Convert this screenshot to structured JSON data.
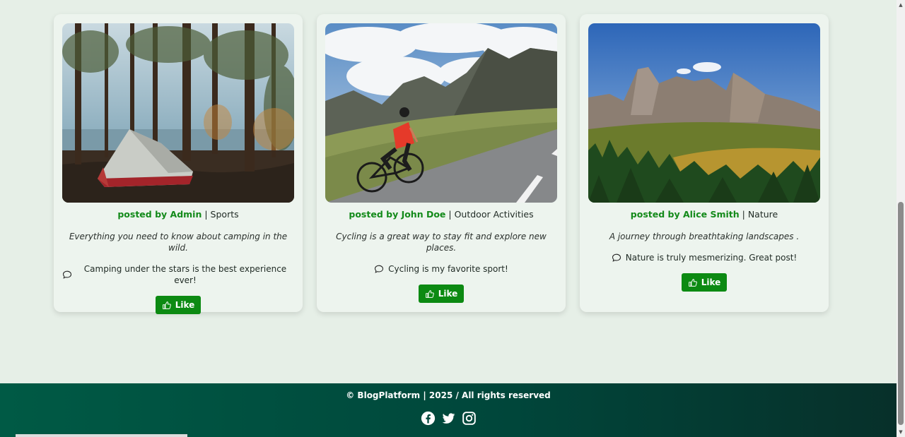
{
  "posts": [
    {
      "author": "posted by Admin",
      "category": "Sports",
      "description": "Everything you need to know about camping in the wild.",
      "comment": "Camping under the stars is the best experience ever!",
      "like_label": "Like",
      "image": "forest-tent-photo"
    },
    {
      "author": "posted by John Doe",
      "category": "Outdoor Activities",
      "description": "Cycling is a great way to stay fit and explore new places.",
      "comment": "Cycling is my favorite sport!",
      "like_label": "Like",
      "image": "mountain-cyclist-photo"
    },
    {
      "author": "posted by Alice Smith",
      "category": "Nature",
      "description": "A journey through breathtaking landscapes .",
      "comment": "Nature is truly mesmerizing. Great post!",
      "like_label": "Like",
      "image": "dolomites-landscape-photo"
    }
  ],
  "footer": {
    "copyright": "© BlogPlatform | 2025 / All rights reserved",
    "social_icons": [
      "facebook-icon",
      "twitter-icon",
      "instagram-icon"
    ]
  },
  "colors": {
    "accent_green": "#0c8a12",
    "author_green": "#138a1a",
    "page_bg": "#e6efe7",
    "card_bg": "#edf4ee",
    "footer_bg": "#00473b"
  }
}
